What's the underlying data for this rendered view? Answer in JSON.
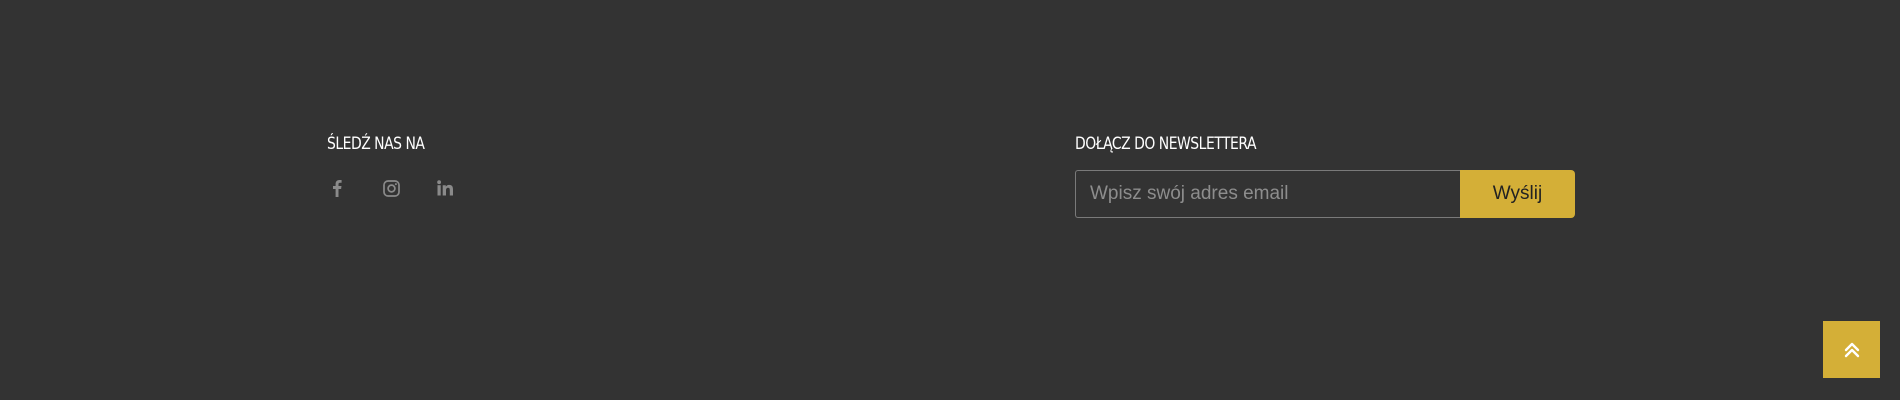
{
  "footer": {
    "follow": {
      "heading": "ŚLEDŹ NAS NA",
      "icons": [
        "facebook-icon",
        "instagram-icon",
        "linkedin-icon"
      ],
      "icon_color": "#8a8a8a"
    },
    "newsletter": {
      "heading": "DOŁĄCZ DO NEWSLETTERA",
      "email_placeholder": "Wpisz swój adres email",
      "email_value": "",
      "submit_label": "Wyślij"
    },
    "scroll_top_icon": "double-chevron-up-icon"
  },
  "colors": {
    "background": "#333333",
    "accent": "#d4af37",
    "heading_text": "#ffffff"
  }
}
